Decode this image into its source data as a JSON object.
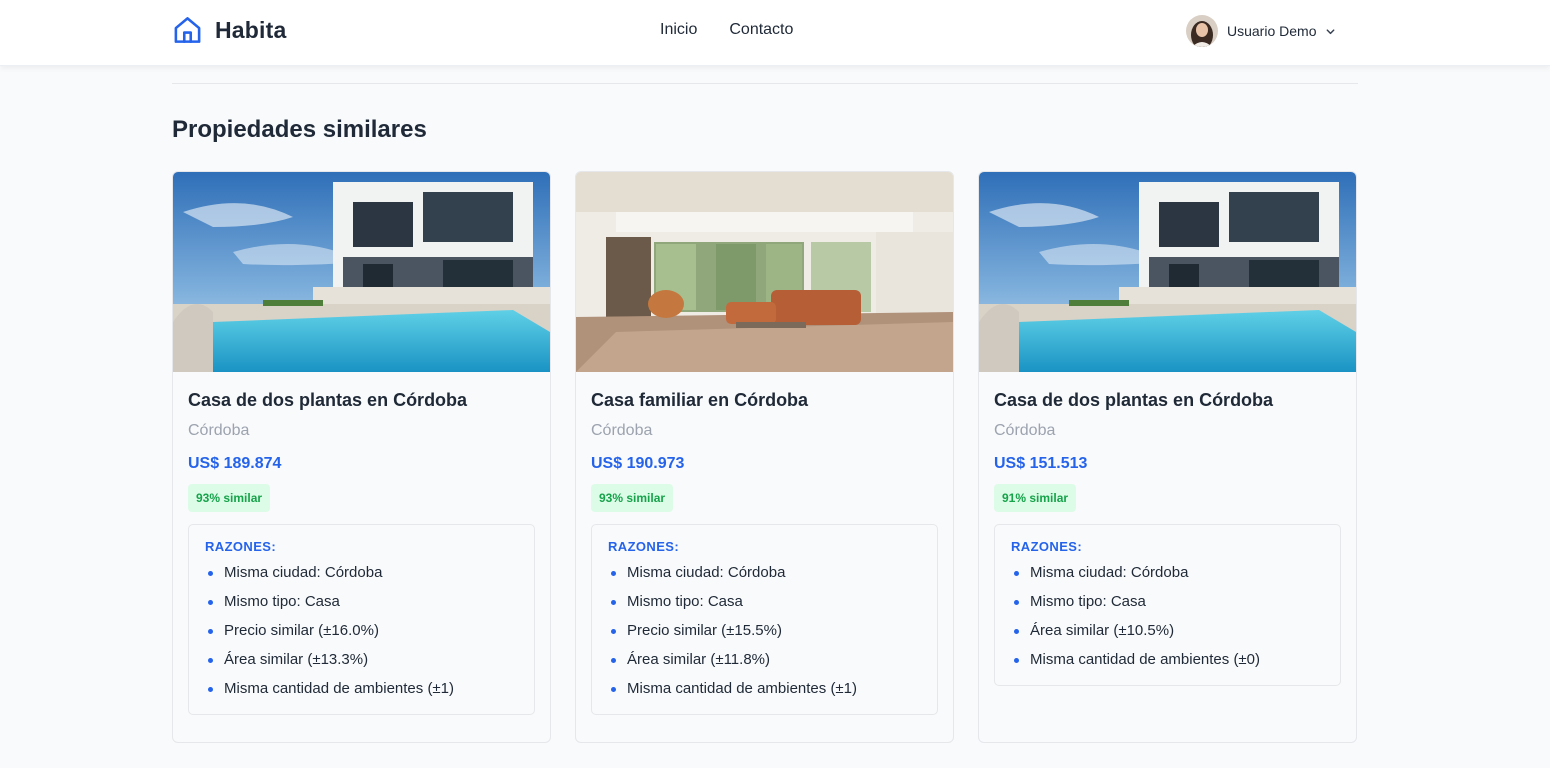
{
  "header": {
    "brand": "Habita",
    "nav": [
      "Inicio",
      "Contacto"
    ],
    "user": "Usuario Demo"
  },
  "section": {
    "title": "Propiedades similares"
  },
  "cards": [
    {
      "image": "modern-house-with-pool",
      "title": "Casa de dos plantas en Córdoba",
      "city": "Córdoba",
      "price": "US$ 189.874",
      "similarity": "93% similar",
      "reasons_title": "RAZONES:",
      "reasons": [
        "Misma ciudad: Córdoba",
        "Mismo tipo: Casa",
        "Precio similar (±16.0%)",
        "Área similar (±13.3%)",
        "Misma cantidad de ambientes (±1)"
      ]
    },
    {
      "image": "living-room-interior",
      "title": "Casa familiar en Córdoba",
      "city": "Córdoba",
      "price": "US$ 190.973",
      "similarity": "93% similar",
      "reasons_title": "RAZONES:",
      "reasons": [
        "Misma ciudad: Córdoba",
        "Mismo tipo: Casa",
        "Precio similar (±15.5%)",
        "Área similar (±11.8%)",
        "Misma cantidad de ambientes (±1)"
      ]
    },
    {
      "image": "modern-house-with-pool",
      "title": "Casa de dos plantas en Córdoba",
      "city": "Córdoba",
      "price": "US$ 151.513",
      "similarity": "91% similar",
      "reasons_title": "RAZONES:",
      "reasons": [
        "Misma ciudad: Córdoba",
        "Mismo tipo: Casa",
        "Área similar (±10.5%)",
        "Misma cantidad de ambientes (±0)"
      ]
    }
  ],
  "colors": {
    "accent": "#2563eb",
    "badge_text": "#16a34a",
    "badge_bg": "#dcfce7",
    "background": "#f8fafc"
  }
}
